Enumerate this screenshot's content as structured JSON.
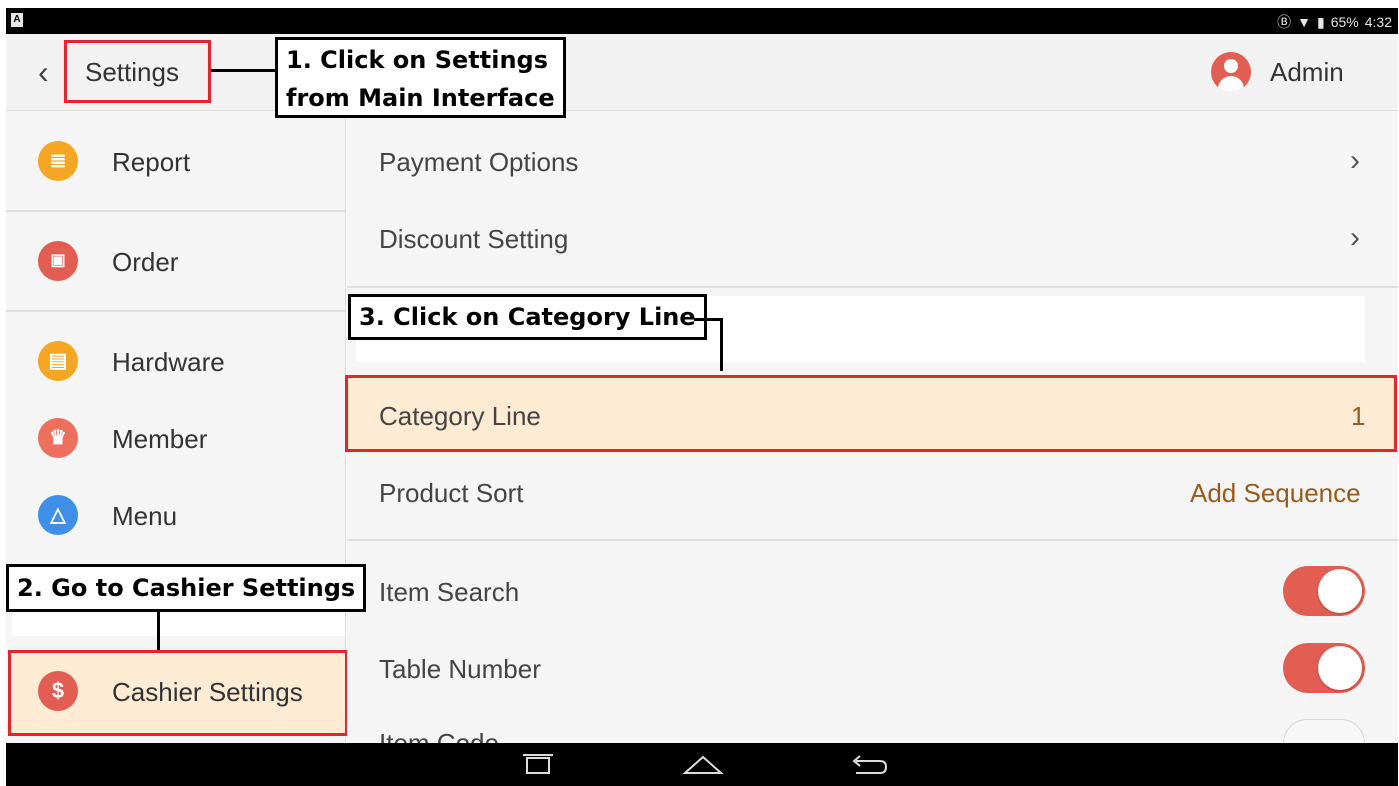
{
  "status_bar": {
    "battery": "65%",
    "time": "4:32"
  },
  "header": {
    "back_icon": "chevron-left-icon",
    "title": "Settings",
    "user_name": "Admin"
  },
  "sidebar": {
    "items": [
      {
        "label": "Report",
        "icon": "report-icon",
        "color": "#f5a623"
      },
      {
        "label": "Order",
        "icon": "order-icon",
        "color": "#e25d52"
      },
      {
        "label": "Hardware",
        "icon": "printer-icon",
        "color": "#f5a623"
      },
      {
        "label": "Member",
        "icon": "crown-icon",
        "color": "#ef6f5e"
      },
      {
        "label": "Menu",
        "icon": "bag-icon",
        "color": "#3d8fe8"
      },
      {
        "label": "Cashier Settings",
        "icon": "dollar-icon",
        "color": "#e25d52",
        "selected": true
      }
    ]
  },
  "main": {
    "rows": [
      {
        "label": "Payment Options",
        "accessory": "chevron"
      },
      {
        "label": "Discount Setting",
        "accessory": "chevron"
      },
      {
        "label": "Category Line",
        "value": "1",
        "highlighted": true
      },
      {
        "label": "Product Sort",
        "value": "Add Sequence"
      },
      {
        "label": "Item Search",
        "toggle": true
      },
      {
        "label": "Table Number",
        "toggle": true
      },
      {
        "label": "Item Code",
        "toggle": false
      }
    ]
  },
  "annotations": {
    "step1_line1": "1. Click on Settings",
    "step1_line2": "from Main Interface",
    "step2": "2. Go to Cashier Settings",
    "step3": "3. Click on Category Line"
  },
  "colors": {
    "accent": "#e25d52",
    "highlight_bg": "#fdecd3",
    "annotation_border": "#e0262f",
    "value_text": "#9a5a1a"
  }
}
